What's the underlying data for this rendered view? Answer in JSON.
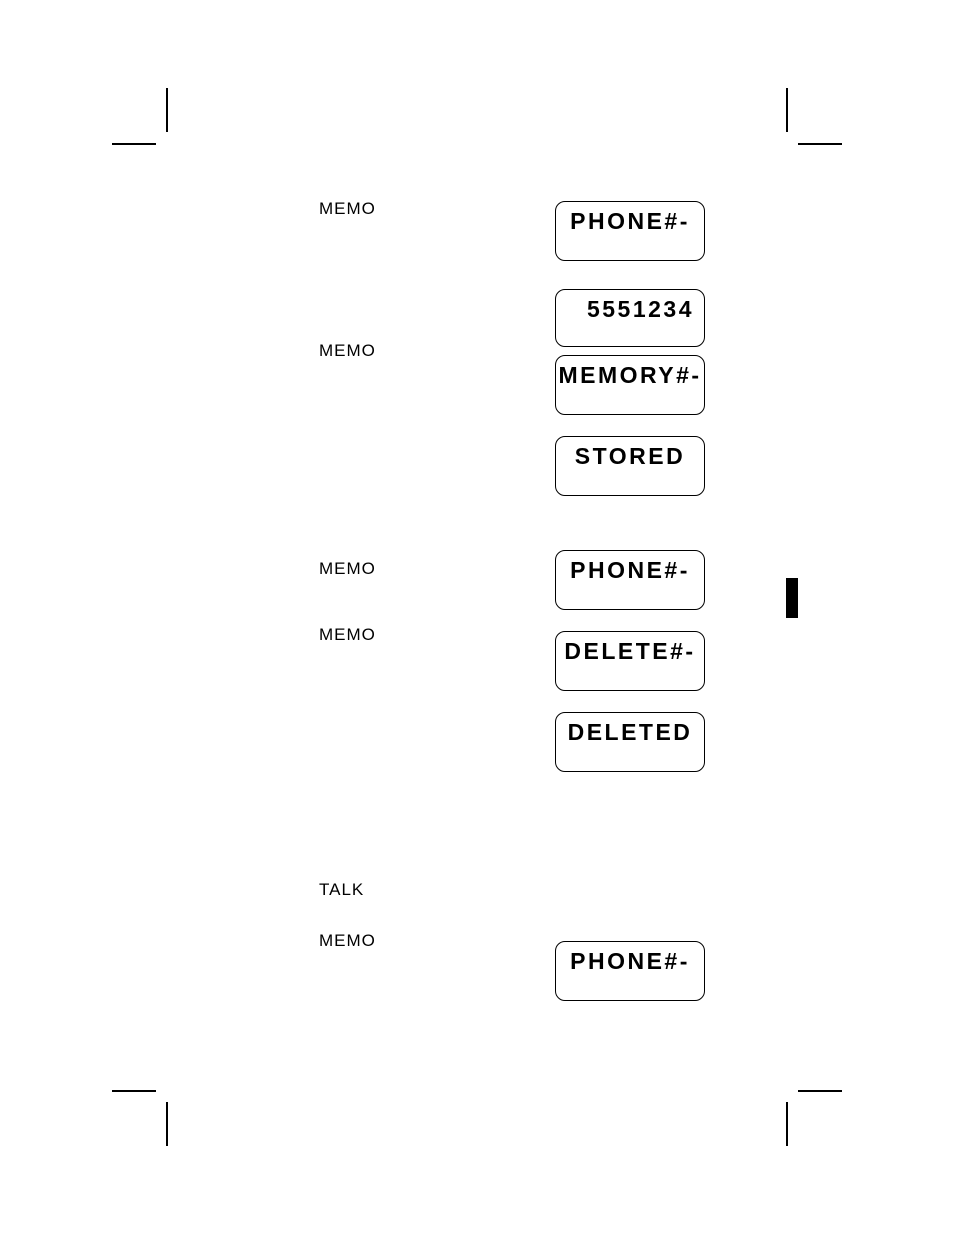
{
  "labels": {
    "memo1": "MEMO",
    "memo2": "MEMO",
    "memo3": "MEMO",
    "memo4": "MEMO",
    "talk": "TALK",
    "memo5": "MEMO"
  },
  "lcd": {
    "phone1": "PHONE#-",
    "number": "5551234",
    "memory": "MEMORY#-",
    "stored": "STORED",
    "phone2": "PHONE#-",
    "delete": "DELETE#-",
    "deleted": "DELETED",
    "phone3": "PHONE#-"
  }
}
